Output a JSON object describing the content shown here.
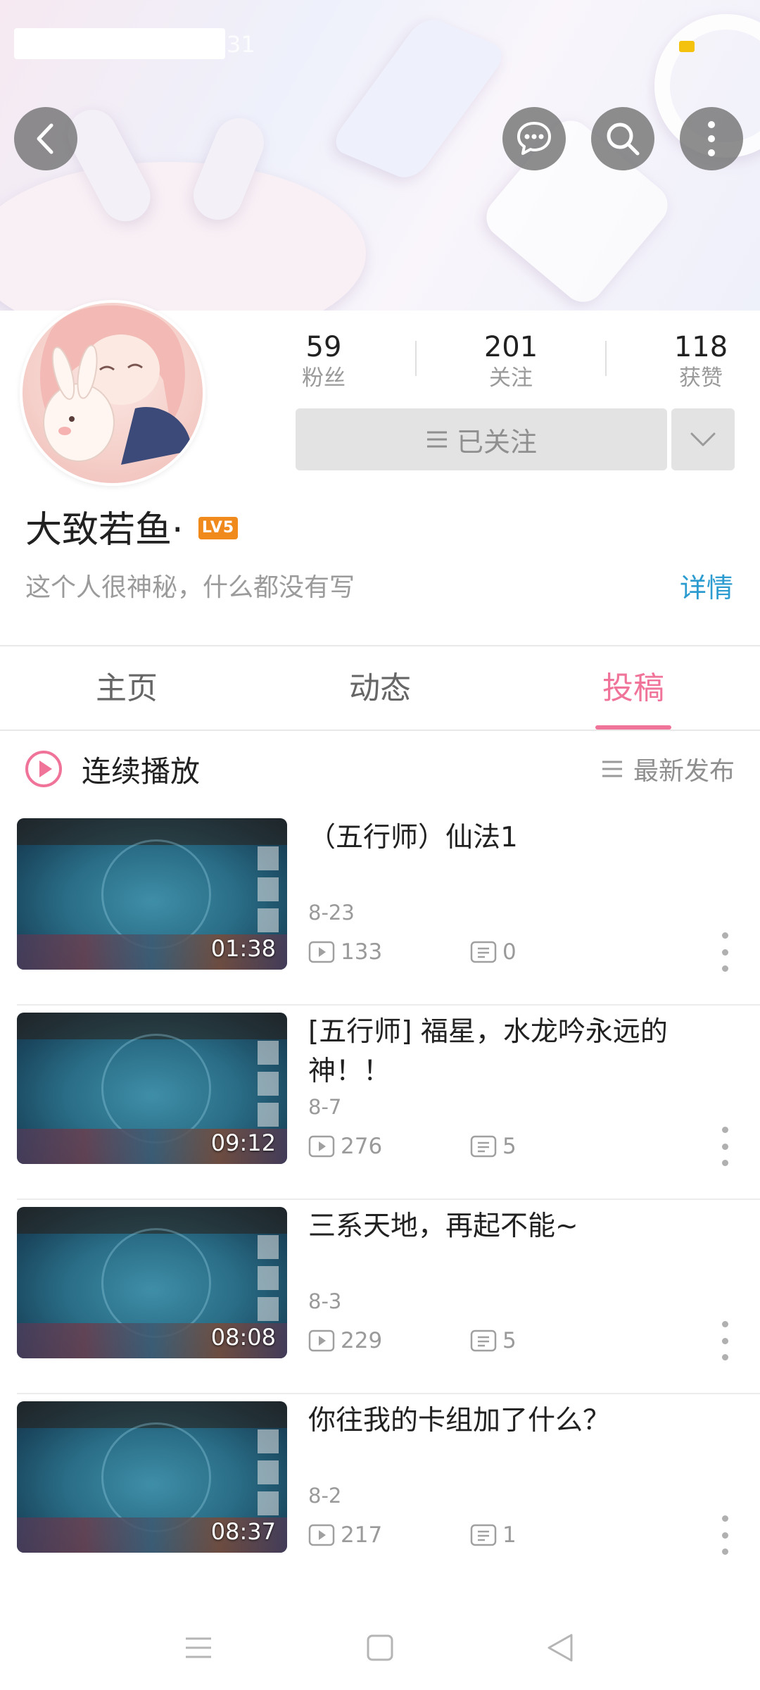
{
  "status_bar": {
    "time_fragment": "31"
  },
  "stats": [
    {
      "key": "fans",
      "value": "59",
      "label": "粉丝"
    },
    {
      "key": "following",
      "value": "201",
      "label": "关注"
    },
    {
      "key": "likes",
      "value": "118",
      "label": "获赞"
    }
  ],
  "follow_button": {
    "label": "已关注"
  },
  "profile": {
    "name": "大致若鱼·",
    "level": "LV5",
    "bio": "这个人很神秘，什么都没有写",
    "detail_link": "详情"
  },
  "tabs": [
    {
      "label": "主页",
      "active": false
    },
    {
      "label": "动态",
      "active": false
    },
    {
      "label": "投稿",
      "active": true
    }
  ],
  "list_header": {
    "autoplay_label": "连续播放",
    "sort_label": "最新发布"
  },
  "videos": [
    {
      "title": "（五行师）仙法1",
      "date": "8-23",
      "plays": "133",
      "comments": "0",
      "duration": "01:38"
    },
    {
      "title": "[五行师] 福星，水龙吟永远的神！！",
      "date": "8-7",
      "plays": "276",
      "comments": "5",
      "duration": "09:12"
    },
    {
      "title": "三系天地，再起不能~",
      "date": "8-3",
      "plays": "229",
      "comments": "5",
      "duration": "08:08"
    },
    {
      "title": "你往我的卡组加了什么？",
      "date": "8-2",
      "plays": "217",
      "comments": "1",
      "duration": "08:37"
    }
  ],
  "colors": {
    "accent_pink": "#f0739a",
    "link_blue": "#2b9bd0",
    "level_orange": "#f08a1c",
    "button_gray": "#e3e3e3"
  },
  "icons": {
    "header": [
      "back-arrow-icon",
      "chat-bubble-icon",
      "search-icon",
      "more-vertical-icon"
    ],
    "nav": [
      "menu-icon",
      "home-square-icon",
      "back-triangle-icon"
    ]
  }
}
